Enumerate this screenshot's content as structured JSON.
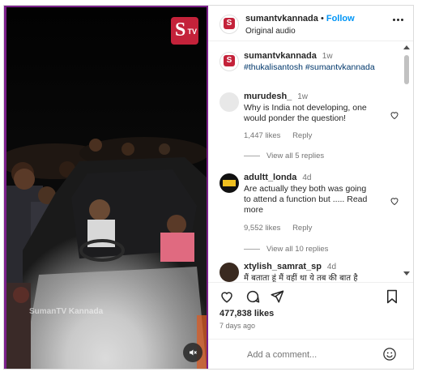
{
  "media": {
    "logo_text_s": "S",
    "logo_text_tv": "TV",
    "watermark": "SumanTV Kannada",
    "mute_icon": "speaker-muted-icon"
  },
  "post": {
    "username": "sumantvkannada",
    "separator": "•",
    "follow_label": "Follow",
    "audio": "Original audio",
    "more_icon": "more-horizontal-icon"
  },
  "caption": {
    "username": "sumantvkannada",
    "time": "1w",
    "hashtags": "#thukalisantosh #sumantvkannada"
  },
  "comments": [
    {
      "username": "murudesh_",
      "time": "1w",
      "text": "Why is India not developing, one would ponder the question!",
      "likes": "1,447 likes",
      "reply_label": "Reply",
      "view_replies": "View all 5 replies"
    },
    {
      "username": "adultt_londa",
      "time": "4d",
      "text": "Are actually they both was going to attend a function but ..... Read more",
      "likes": "9,552 likes",
      "reply_label": "Reply",
      "view_replies": "View all 10 replies"
    },
    {
      "username": "xtylish_samrat_sp",
      "time": "4d",
      "text": "मैं बताता हूं मैं वहीं था ये तब की बात है"
    }
  ],
  "actions": {
    "likes": "477,838 likes",
    "ago": "7 days ago"
  },
  "composer": {
    "placeholder": "Add a comment...",
    "emoji_icon": "emoji-icon"
  },
  "colors": {
    "accent": "#0095f6",
    "brand": "#c4223a",
    "frame": "#7a1f8a"
  }
}
